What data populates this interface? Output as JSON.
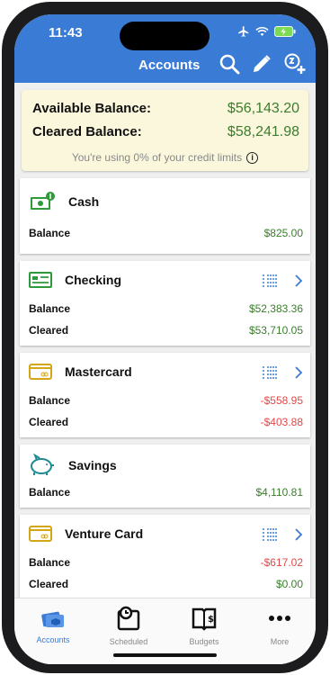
{
  "status": {
    "time": "11:43"
  },
  "nav": {
    "title": "Accounts"
  },
  "summary": {
    "available_label": "Available Balance:",
    "available_value": "$56,143.20",
    "cleared_label": "Cleared Balance:",
    "cleared_value": "$58,241.98",
    "credit_note": "You're using 0% of your credit limits"
  },
  "accounts": [
    {
      "name": "Cash",
      "balance_label": "Balance",
      "balance": "$825.00"
    },
    {
      "name": "Checking",
      "balance_label": "Balance",
      "balance": "$52,383.36",
      "cleared_label": "Cleared",
      "cleared": "$53,710.05"
    },
    {
      "name": "Mastercard",
      "balance_label": "Balance",
      "balance": "-$558.95",
      "cleared_label": "Cleared",
      "cleared": "-$403.88"
    },
    {
      "name": "Savings",
      "balance_label": "Balance",
      "balance": "$4,110.81"
    },
    {
      "name": "Venture Card",
      "balance_label": "Balance",
      "balance": "-$617.02",
      "cleared_label": "Cleared",
      "cleared": "$0.00"
    }
  ],
  "tabs": [
    {
      "label": "Accounts"
    },
    {
      "label": "Scheduled"
    },
    {
      "label": "Budgets"
    },
    {
      "label": "More"
    }
  ],
  "colors": {
    "accent": "#3a7bd5",
    "positive": "#3a7d2c",
    "negative": "#e04848"
  }
}
